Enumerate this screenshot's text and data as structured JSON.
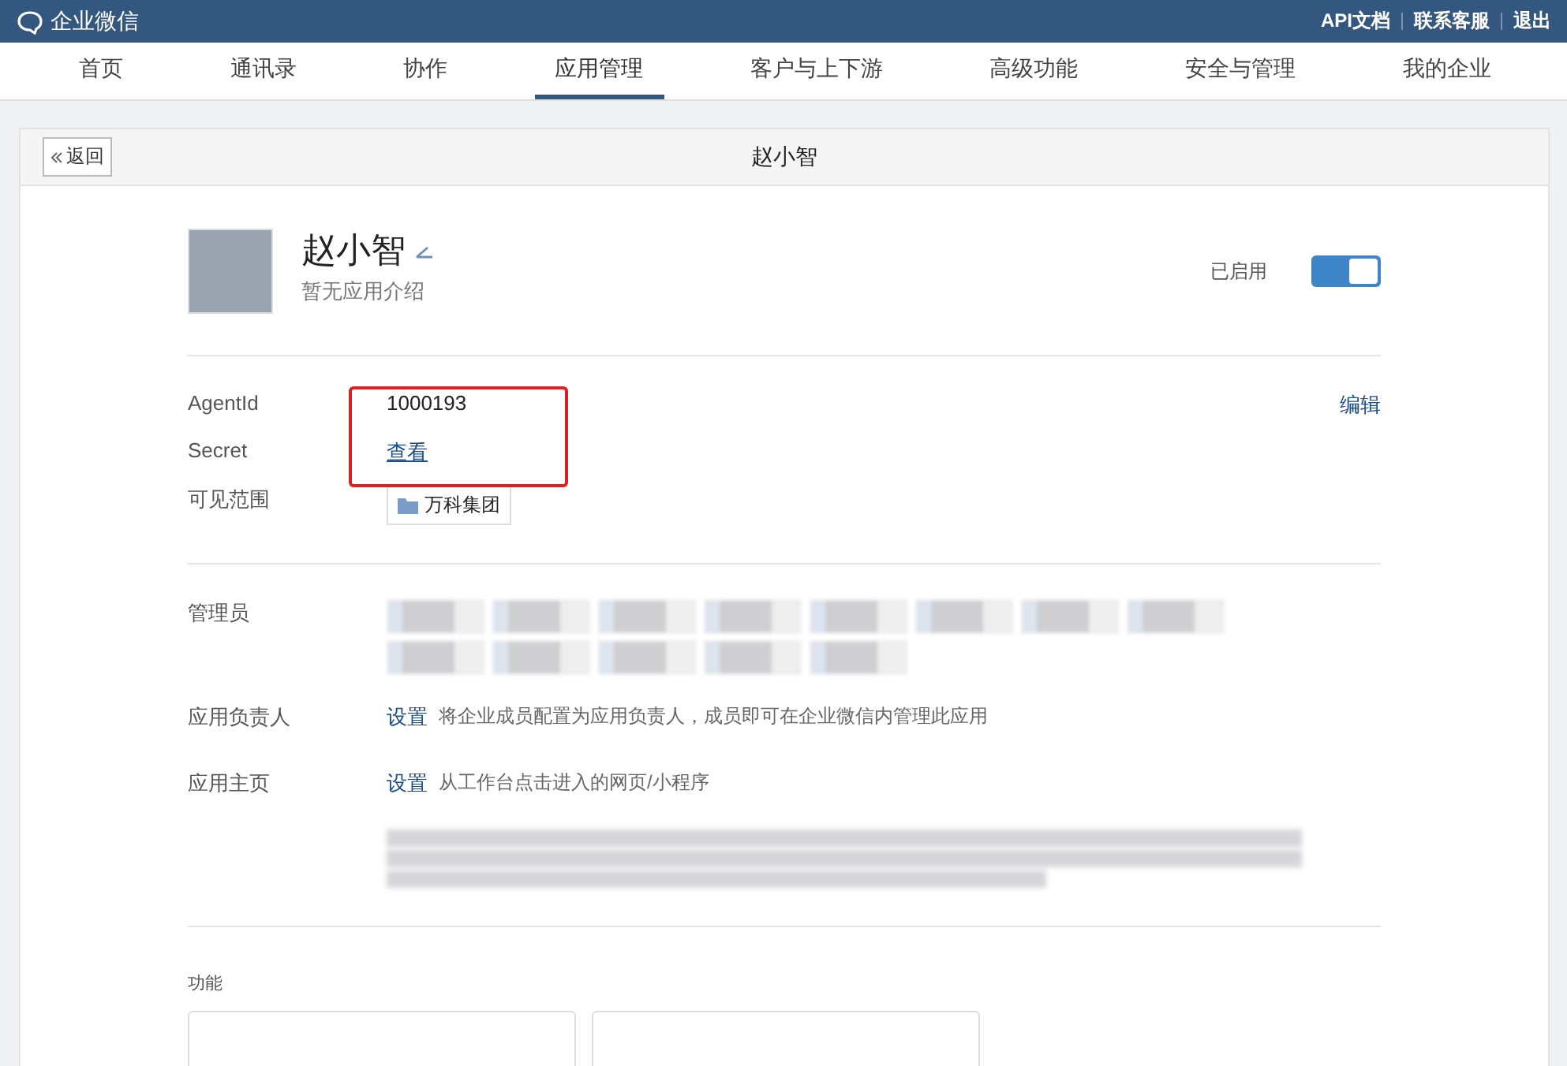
{
  "topbar": {
    "logo": "企业微信",
    "links": [
      "API文档",
      "联系客服",
      "退出"
    ]
  },
  "nav": [
    {
      "label": "首页",
      "selected": false
    },
    {
      "label": "通讯录",
      "selected": false
    },
    {
      "label": "协作",
      "selected": false
    },
    {
      "label": "应用管理",
      "selected": true
    },
    {
      "label": "客户与上下游",
      "selected": false
    },
    {
      "label": "高级功能",
      "selected": false
    },
    {
      "label": "安全与管理",
      "selected": false
    },
    {
      "label": "我的企业",
      "selected": false
    }
  ],
  "header": {
    "back": "返回",
    "title": "赵小智"
  },
  "app": {
    "name": "赵小智",
    "description": "暂无应用介绍",
    "status_label": "已启用",
    "enabled": true
  },
  "info": {
    "agentid_label": "AgentId",
    "agentid": "1000193",
    "secret_label": "Secret",
    "secret_link": "查看",
    "scope_label": "可见范围",
    "scope_tag": "万科集团",
    "edit": "编辑"
  },
  "admins": {
    "label": "管理员"
  },
  "owner": {
    "label": "应用负责人",
    "action": "设置",
    "hint": "将企业成员配置为应用负责人，成员即可在企业微信内管理此应用"
  },
  "homepage": {
    "label": "应用主页",
    "action": "设置",
    "hint": "从工作台点击进入的网页/小程序"
  },
  "features": {
    "label": "功能"
  }
}
